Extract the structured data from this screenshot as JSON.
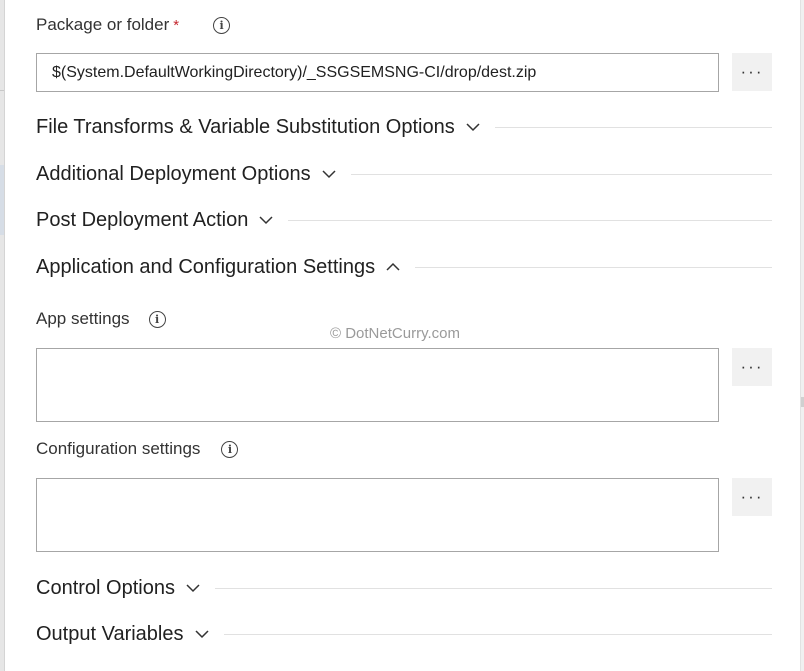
{
  "package": {
    "label": "Package or folder",
    "required_marker": "*",
    "value": "$(System.DefaultWorkingDirectory)/_SSGSEMSNG-CI/drop/dest.zip",
    "browse_label": "···"
  },
  "sections": {
    "file_transforms": "File Transforms & Variable Substitution Options",
    "additional_deployment": "Additional Deployment Options",
    "post_deployment": "Post Deployment Action",
    "app_config": "Application and Configuration Settings",
    "control_options": "Control Options",
    "output_variables": "Output Variables"
  },
  "app_settings": {
    "label": "App settings",
    "value": "",
    "browse_label": "···"
  },
  "configuration_settings": {
    "label": "Configuration settings",
    "value": "",
    "browse_label": "···"
  },
  "watermark": "© DotNetCurry.com",
  "icons": {
    "info": "i",
    "chevron_collapsed": "chevron-down-icon",
    "chevron_expanded": "chevron-up-icon"
  },
  "colors": {
    "required": "#c4262e",
    "border": "#a6a6a6",
    "button_bg": "#f1f1f1",
    "divider": "#e1e1e1"
  }
}
